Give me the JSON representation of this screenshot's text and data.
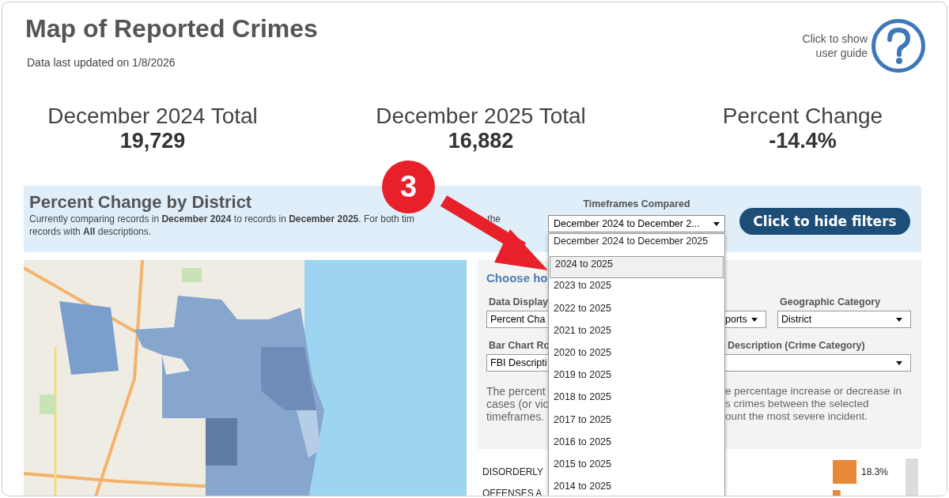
{
  "header": {
    "title": "Map of Reported Crimes",
    "updated": "Data last updated on 1/8/2026",
    "help_text": "Click to show\nuser guide"
  },
  "totals": [
    {
      "label": "December 2024 Total",
      "value": "19,729"
    },
    {
      "label": "December 2025 Total",
      "value": "16,882"
    },
    {
      "label": "Percent Change",
      "value": "-14.4%"
    }
  ],
  "band": {
    "title": "Percent Change by District",
    "description": "Currently comparing records in **December 2024** to records in **December 2025**. For both tim",
    "description_tail": "the",
    "description_line_2": "records with **All** descriptions.",
    "timeframes_label": "Timeframes Compared",
    "timeframes_value": "December 2024 to December 2...",
    "hide_button": "Click to hide filters"
  },
  "timeframe_options": [
    {
      "label": "December 2024 to December 2025",
      "selected": false
    },
    {
      "label": "2024 to 2025",
      "selected": true
    },
    {
      "label": "2023 to 2025",
      "selected": false
    },
    {
      "label": "2022 to 2025",
      "selected": false
    },
    {
      "label": "2021 to 2025",
      "selected": false
    },
    {
      "label": "2020 to 2025",
      "selected": false
    },
    {
      "label": "2019 to 2025",
      "selected": false
    },
    {
      "label": "2018 to 2025",
      "selected": false
    },
    {
      "label": "2017 to 2025",
      "selected": false
    },
    {
      "label": "2016 to 2025",
      "selected": false
    },
    {
      "label": "2015 to 2025",
      "selected": false
    },
    {
      "label": "2014 to 2025",
      "selected": false
    }
  ],
  "filters": {
    "heading": "Choose ho",
    "data_display_label": "Data Display",
    "data_display_value": "Percent Cha",
    "middle_value": "ports",
    "geo_label": "Geographic Category",
    "geo_value": "District",
    "bar_chart_label": "Bar Chart Ro",
    "bar_chart_value": "FBI Descripti",
    "description_label": "Description (Crime Category)",
    "note_left": [
      "The percent",
      "cases (or vic",
      "timeframes."
    ],
    "note_right": [
      "e percentage increase or decrease in",
      "s crimes between the selected",
      "ount the most severe incident."
    ]
  },
  "bar_chart": {
    "chart_data": {
      "type": "bar",
      "orientation": "horizontal",
      "categories": [
        "DISORDERLY",
        "OFFENSES A"
      ],
      "values": [
        18.3,
        6.0
      ],
      "value_labels": [
        "18.3%",
        null
      ]
    }
  },
  "annotation": {
    "step": "3"
  }
}
